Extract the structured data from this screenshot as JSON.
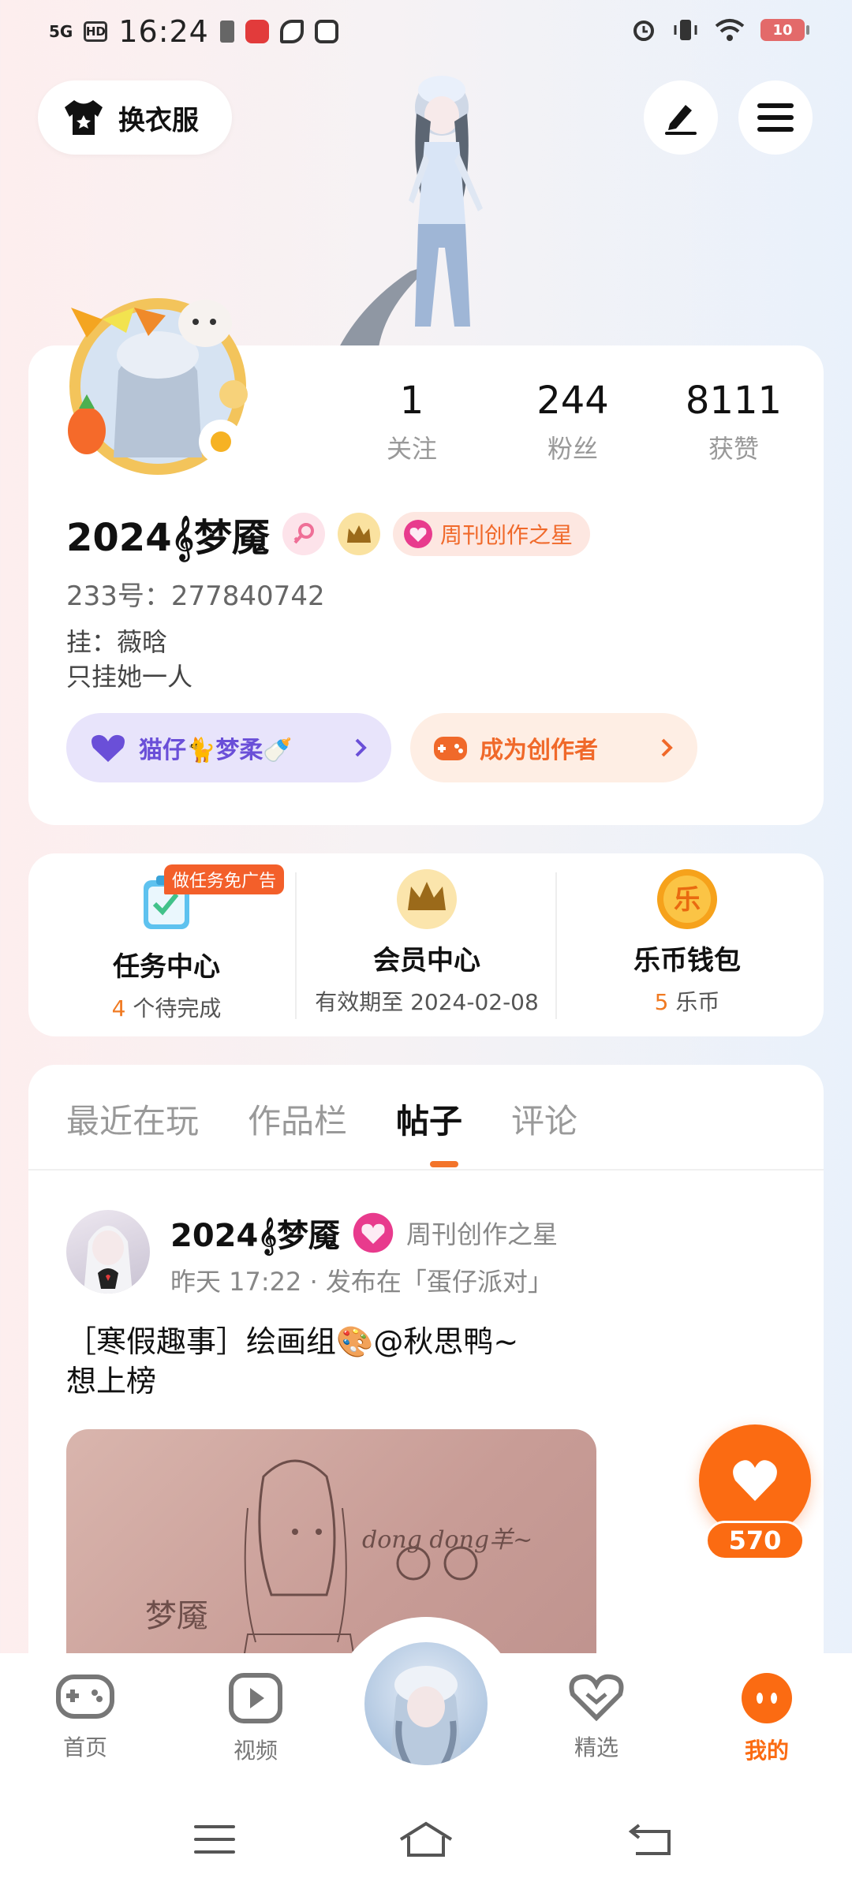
{
  "status_bar": {
    "network": "5G",
    "hd": "HD",
    "time": "16:24",
    "battery": "10"
  },
  "top": {
    "outfit_label": "换衣服"
  },
  "profile": {
    "stats": [
      {
        "num": "1",
        "label": "关注"
      },
      {
        "num": "244",
        "label": "粉丝"
      },
      {
        "num": "8111",
        "label": "获赞"
      }
    ],
    "username": "2024𝄞梦魇",
    "star_badge": "周刊创作之星",
    "uid": "233号：277840742",
    "bio_line1": "挂：薇晗",
    "bio_line2": "只挂她一人",
    "pill_left": "猫仔🐈梦柔🍼",
    "pill_right": "成为创作者"
  },
  "services": [
    {
      "title": "任务中心",
      "sub_num": "4",
      "sub_text": " 个待完成",
      "tag": "做任务免广告"
    },
    {
      "title": "会员中心",
      "sub_text": "有效期至 2024-02-08"
    },
    {
      "title": "乐币钱包",
      "sub_num": "5",
      "sub_text": " 乐币",
      "coin_char": "乐"
    }
  ],
  "tabs": [
    "最近在玩",
    "作品栏",
    "帖子",
    "评论"
  ],
  "post": {
    "author": "2024𝄞梦魇",
    "badge": "周刊创作之星",
    "meta": "昨天 17:22 · 发布在「蛋仔派对」",
    "text_line1": "［寒假趣事］绘画组🎨@秋思鸭~",
    "text_line2": "想上榜",
    "sketch_text1": "dong dong羊~",
    "sketch_text2": "梦魇"
  },
  "like": {
    "count": "570"
  },
  "nav": [
    {
      "label": "首页"
    },
    {
      "label": "视频"
    },
    {
      "label": "精选"
    },
    {
      "label": "我的"
    }
  ],
  "colors": {
    "accent": "#fb6b12",
    "badge_pink": "#f0692a",
    "pill_left_bg": "#e8e4fb",
    "pill_left_text": "#6a4fd8",
    "pill_right_bg": "#feeee4",
    "pill_right_text": "#f0692a"
  }
}
